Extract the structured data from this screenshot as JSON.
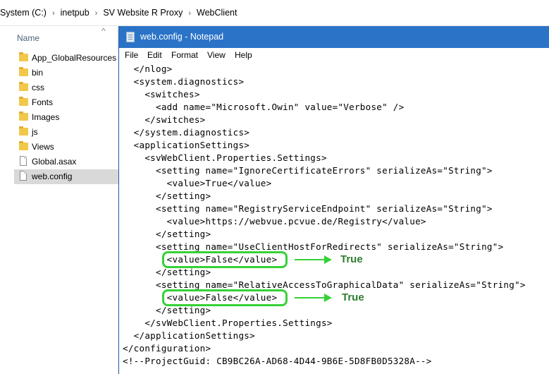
{
  "explorer": {
    "breadcrumb": [
      "System (C:)",
      "inetpub",
      "SV Website R Proxy",
      "WebClient"
    ],
    "column_header": "Name",
    "files": [
      {
        "name": "App_GlobalResources",
        "kind": "folder"
      },
      {
        "name": "bin",
        "kind": "folder"
      },
      {
        "name": "css",
        "kind": "folder"
      },
      {
        "name": "Fonts",
        "kind": "folder"
      },
      {
        "name": "Images",
        "kind": "folder"
      },
      {
        "name": "js",
        "kind": "folder"
      },
      {
        "name": "Views",
        "kind": "folder"
      },
      {
        "name": "Global.asax",
        "kind": "file"
      },
      {
        "name": "web.config",
        "kind": "file",
        "selected": true
      }
    ]
  },
  "notepad": {
    "title": "web.config - Notepad",
    "menu": [
      "File",
      "Edit",
      "Format",
      "View",
      "Help"
    ],
    "lines": [
      "  </nlog>",
      "  <system.diagnostics>",
      "    <switches>",
      "      <add name=\"Microsoft.Owin\" value=\"Verbose\" />",
      "    </switches>",
      "  </system.diagnostics>",
      "  <applicationSettings>",
      "    <svWebClient.Properties.Settings>",
      "      <setting name=\"IgnoreCertificateErrors\" serializeAs=\"String\">",
      "        <value>True</value>",
      "      </setting>",
      "      <setting name=\"RegistryServiceEndpoint\" serializeAs=\"String\">",
      "        <value>https://webvue.pcvue.de/Registry</value>",
      "      </setting>",
      "      <setting name=\"UseClientHostForRedirects\" serializeAs=\"String\">",
      "        <value>False</value>",
      "      </setting>",
      "      <setting name=\"RelativeAccessToGraphicalData\" serializeAs=\"String\">",
      "        <value>False</value>",
      "      </setting>",
      "    </svWebClient.Properties.Settings>",
      "  </applicationSettings>",
      "</configuration>",
      "<!--ProjectGuid: CB9BC26A-AD68-4D44-9B6E-5D8FB0D5328A-->"
    ]
  },
  "annotations": {
    "label_1": "True",
    "label_2": "True",
    "color": "#37d137"
  },
  "colors": {
    "titlebar": "#2b73c7",
    "selection": "#d9d9d9"
  }
}
